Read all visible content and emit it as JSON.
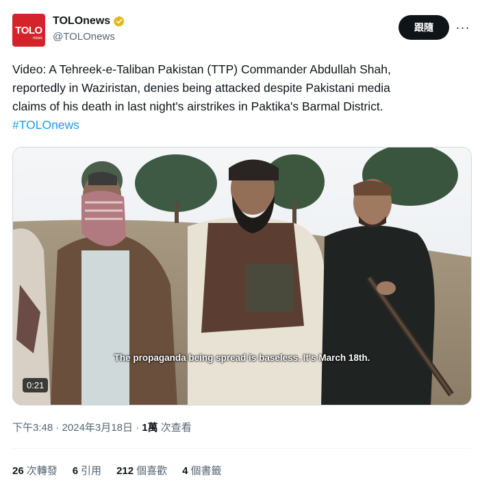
{
  "author": {
    "display_name": "TOLOnews",
    "handle": "@TOLOnews",
    "avatar_text": "TOLO",
    "avatar_sub": "news",
    "verified_icon": "verified-badge-gold"
  },
  "actions": {
    "follow_label": "跟隨",
    "more_label": "···"
  },
  "tweet": {
    "lines": [
      "Video: A Tehreek-e-Taliban Pakistan (TTP) Commander Abdullah Shah,",
      "reportedly in Waziristan, denies being attacked despite Pakistani media",
      "claims of his death in last night's airstrikes in Paktika's Barmal District."
    ],
    "hashtag": "#TOLOnews"
  },
  "video": {
    "caption": "The propaganda being spread is baseless. It's March 18th.",
    "duration": "0:21"
  },
  "meta": {
    "time": "下午3:48",
    "separator1": " · ",
    "date": "2024年3月18日",
    "separator2": " · ",
    "views_count": "1萬",
    "views_label": " 次查看"
  },
  "stats": [
    {
      "count": "26",
      "label": "次轉發"
    },
    {
      "count": "6",
      "label": "引用"
    },
    {
      "count": "212",
      "label": "個喜歡"
    },
    {
      "count": "4",
      "label": "個書籤"
    }
  ],
  "colors": {
    "accent": "#1d9bf0",
    "brand": "#d5232b",
    "verified": "#e2b719"
  }
}
